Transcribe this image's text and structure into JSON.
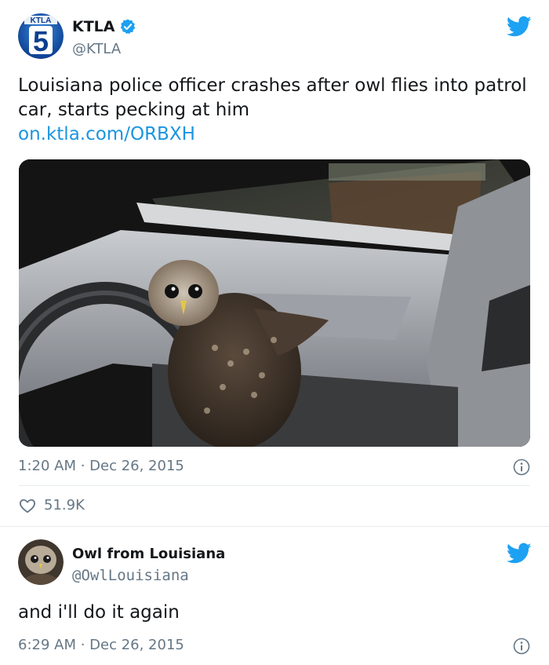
{
  "tweets": [
    {
      "display_name": "KTLA",
      "handle": "@KTLA",
      "verified": true,
      "avatar": {
        "icon": "ktla-5-logo",
        "badge_text": "KTLA",
        "number": "5"
      },
      "text": "Louisiana police officer crashes after owl flies into patrol car, starts pecking at him",
      "link": "on.ktla.com/ORBXH",
      "media": {
        "description_icon": "owl-in-patrol-car-photo"
      },
      "timestamp": "1:20 AM · Dec 26, 2015",
      "likes": "51.9K"
    },
    {
      "display_name": "Owl from Louisiana",
      "handle": "@OwlLouisiana",
      "avatar": {
        "icon": "owl-avatar"
      },
      "text": "and i'll do it again",
      "timestamp": "6:29 AM · Dec 26, 2015"
    }
  ],
  "colors": {
    "twitter_blue": "#1da1f2",
    "link_blue": "#1b95e0",
    "text": "#14171a",
    "secondary": "#657786",
    "divider": "#e6ecf0"
  }
}
